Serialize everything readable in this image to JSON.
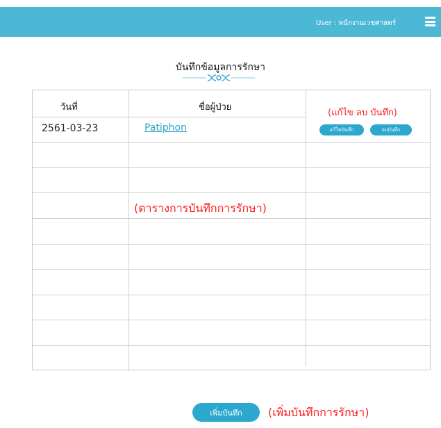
{
  "header": {
    "user_label": "User : พนักงานเวชศาสตร์",
    "menu_icon": "hamburger-menu-icon",
    "bar_color": "#4bb9d6"
  },
  "page": {
    "title": "บันทึกข้อมูลการรักษา"
  },
  "table": {
    "columns": [
      "วันที่",
      "ชื่อผู้ป่วย"
    ],
    "rows": [
      {
        "date": "2561-03-23",
        "patient": "Patiphon",
        "edit_label": "แก้ไขบันทึก",
        "delete_label": "ลบบันทึก"
      }
    ],
    "actions_note": "(แก้ไข ลบ บันทึก)",
    "table_note": "(ตารางการบันทึกการรักษา)"
  },
  "footer": {
    "add_label": "เพิ่มบันทึก",
    "add_note": "(เพิ่มบันทึกการรักษา)"
  },
  "colors": {
    "accent": "#2ca8cf",
    "note": "#ff1a1a"
  }
}
